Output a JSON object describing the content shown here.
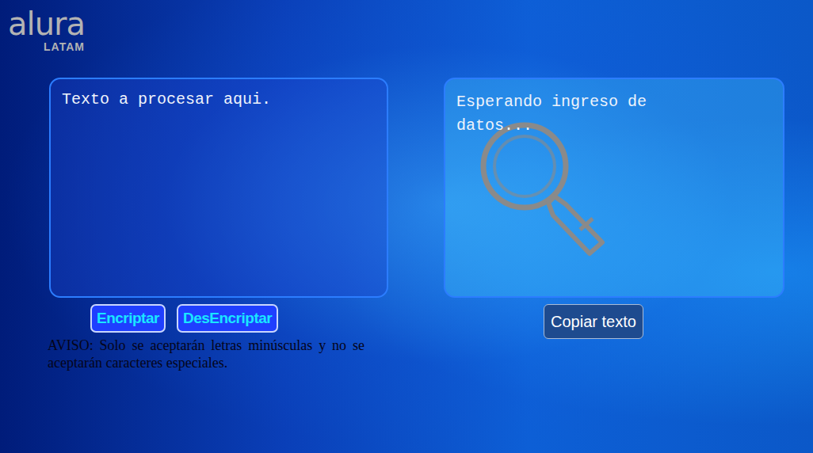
{
  "logo": {
    "name": "alura",
    "region": "LATAM"
  },
  "input": {
    "placeholder": "Texto a procesar aqui."
  },
  "output": {
    "message": "Esperando ingreso de datos..."
  },
  "buttons": [
    {
      "label": "Encriptar"
    },
    {
      "label": "DesEncriptar"
    }
  ],
  "notice": "AVISO: Solo se aceptarán letras minúsculas y no se aceptarán caracteres especiales.",
  "copy_button": {
    "label": "Copiar texto"
  }
}
